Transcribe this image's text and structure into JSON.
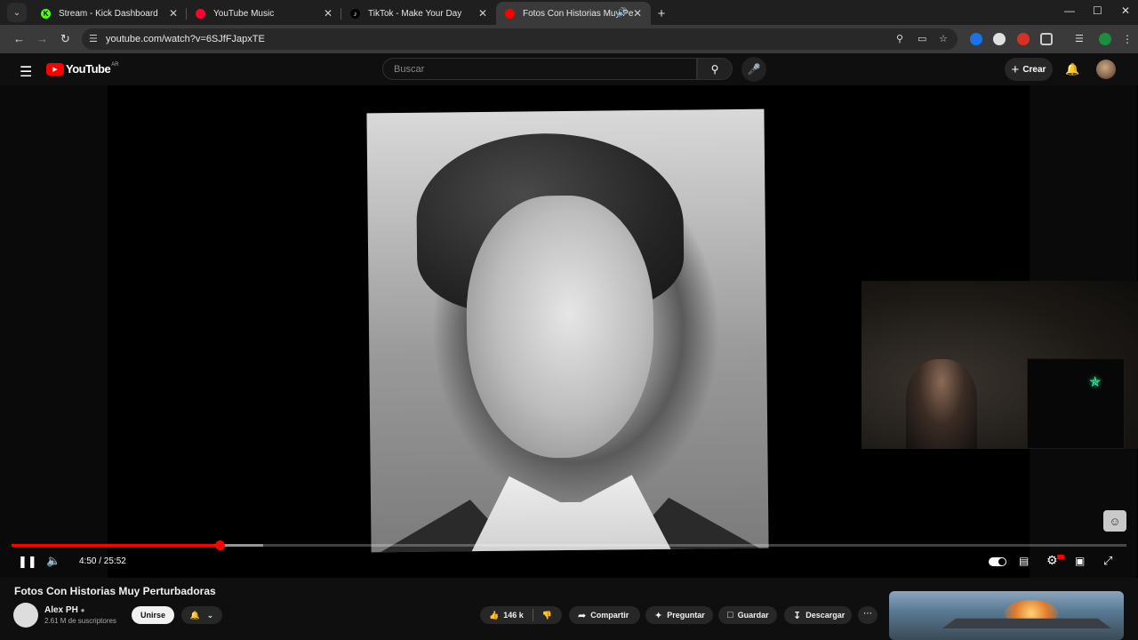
{
  "browser": {
    "tabs": [
      {
        "title": "Stream - Kick Dashboard",
        "favicon_color": "#53fc18",
        "favicon_text": "K"
      },
      {
        "title": "YouTube Music",
        "favicon_color": "#ff0033",
        "favicon_text": "▶"
      },
      {
        "title": "TikTok - Make Your Day",
        "favicon_color": "#000000",
        "favicon_text": "♪"
      },
      {
        "title": "Fotos Con Historias Muy Pe",
        "favicon_color": "#ff0000",
        "favicon_text": "▶",
        "active": true,
        "audio": true
      }
    ],
    "url": "youtube.com/watch?v=6SJfFJapxTE",
    "new_tab_label": "+"
  },
  "youtube": {
    "logo_text": "YouTube",
    "region": "AR",
    "search_placeholder": "Buscar",
    "create_label": "Crear"
  },
  "player": {
    "current_time": "4:50",
    "duration": "25:52",
    "time_display": "4:50 / 25:52",
    "progress_fraction": 0.187,
    "buffered_fraction": 0.226,
    "state": "playing"
  },
  "video": {
    "title": "Fotos Con Historias Muy Perturbadoras",
    "channel_name": "Alex PH",
    "subscribers": "2.61 M de suscriptores",
    "join_label": "Unirse",
    "likes": "146 k",
    "share_label": "Compartir",
    "ask_label": "Preguntar",
    "save_label": "Guardar",
    "download_label": "Descargar"
  },
  "colors": {
    "accent": "#ff0000",
    "background": "#0f0f0f",
    "chip": "#272727"
  }
}
